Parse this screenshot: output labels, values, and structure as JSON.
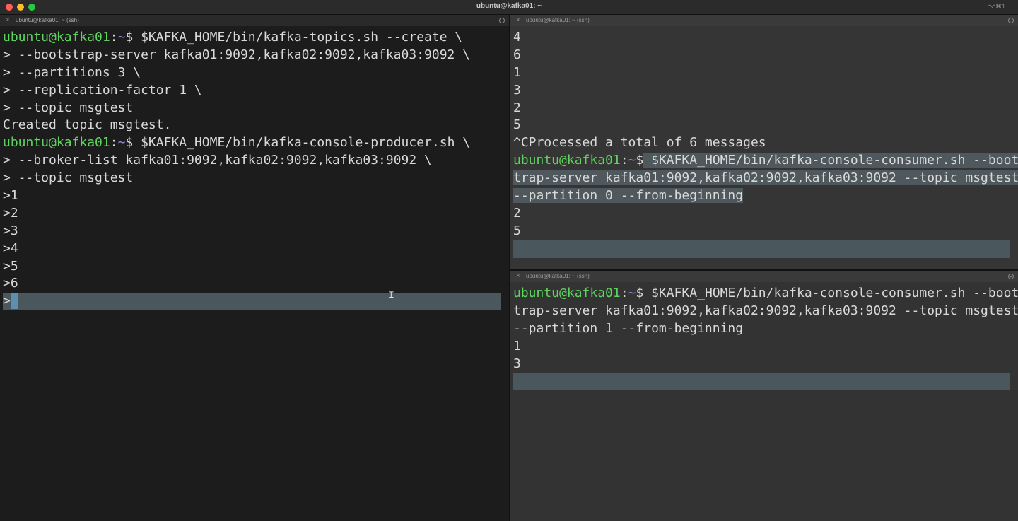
{
  "window": {
    "title": "ubuntu@kafka01: ~",
    "shortcut": "⌥⌘1"
  },
  "prompt": {
    "user_host": "ubuntu@kafka01",
    "sep": ":",
    "path": "~",
    "sym": "$"
  },
  "left_pane": {
    "tab_label": "ubuntu@kafka01: ~ (ssh)",
    "lines": [
      {
        "kind": "prompt",
        "cmd": " $KAFKA_HOME/bin/kafka-topics.sh --create \\"
      },
      {
        "kind": "text",
        "text": "> --bootstrap-server kafka01:9092,kafka02:9092,kafka03:9092 \\"
      },
      {
        "kind": "text",
        "text": "> --partitions 3 \\"
      },
      {
        "kind": "text",
        "text": "> --replication-factor 1 \\"
      },
      {
        "kind": "text",
        "text": "> --topic msgtest"
      },
      {
        "kind": "text",
        "text": "Created topic msgtest."
      },
      {
        "kind": "prompt",
        "cmd": " $KAFKA_HOME/bin/kafka-console-producer.sh \\"
      },
      {
        "kind": "text",
        "text": "> --broker-list kafka01:9092,kafka02:9092,kafka03:9092 \\"
      },
      {
        "kind": "text",
        "text": "> --topic msgtest"
      },
      {
        "kind": "text",
        "text": ">1"
      },
      {
        "kind": "text",
        "text": ">2"
      },
      {
        "kind": "text",
        "text": ">3"
      },
      {
        "kind": "text",
        "text": ">4"
      },
      {
        "kind": "text",
        "text": ">5"
      },
      {
        "kind": "text",
        "text": ">6"
      }
    ],
    "cursor_prefix": ">"
  },
  "top_right_pane": {
    "tab_label": "ubuntu@kafka01: ~ (ssh)",
    "lines": [
      {
        "kind": "text",
        "text": "4"
      },
      {
        "kind": "text",
        "text": "6"
      },
      {
        "kind": "text",
        "text": "1"
      },
      {
        "kind": "text",
        "text": "3"
      },
      {
        "kind": "text",
        "text": "2"
      },
      {
        "kind": "text",
        "text": "5"
      },
      {
        "kind": "text",
        "text": "^CProcessed a total of 6 messages"
      },
      {
        "kind": "prompt",
        "cmd": " $KAFKA_HOME/bin/kafka-console-consumer.sh --boots",
        "selected": true
      },
      {
        "kind": "text",
        "text": "trap-server kafka01:9092,kafka02:9092,kafka03:9092 --topic msgtest",
        "selected": true
      },
      {
        "kind": "text",
        "text": "--partition 0 --from-beginning",
        "selected": true
      },
      {
        "kind": "text",
        "text": "2"
      },
      {
        "kind": "text",
        "text": "5"
      }
    ]
  },
  "bottom_right_pane": {
    "tab_label": "ubuntu@kafka01: ~ (ssh)",
    "lines": [
      {
        "kind": "prompt",
        "cmd": " $KAFKA_HOME/bin/kafka-console-consumer.sh --boots"
      },
      {
        "kind": "text",
        "text": "trap-server kafka01:9092,kafka02:9092,kafka03:9092 --topic msgtest"
      },
      {
        "kind": "text",
        "text": "--partition 1 --from-beginning"
      },
      {
        "kind": "text",
        "text": "1"
      },
      {
        "kind": "text",
        "text": "3"
      }
    ]
  },
  "colors": {
    "prompt_user": "#5fd35f",
    "prompt_path": "#8c8fe0",
    "text": "#d9d9d9",
    "selection": "#4f585c"
  }
}
